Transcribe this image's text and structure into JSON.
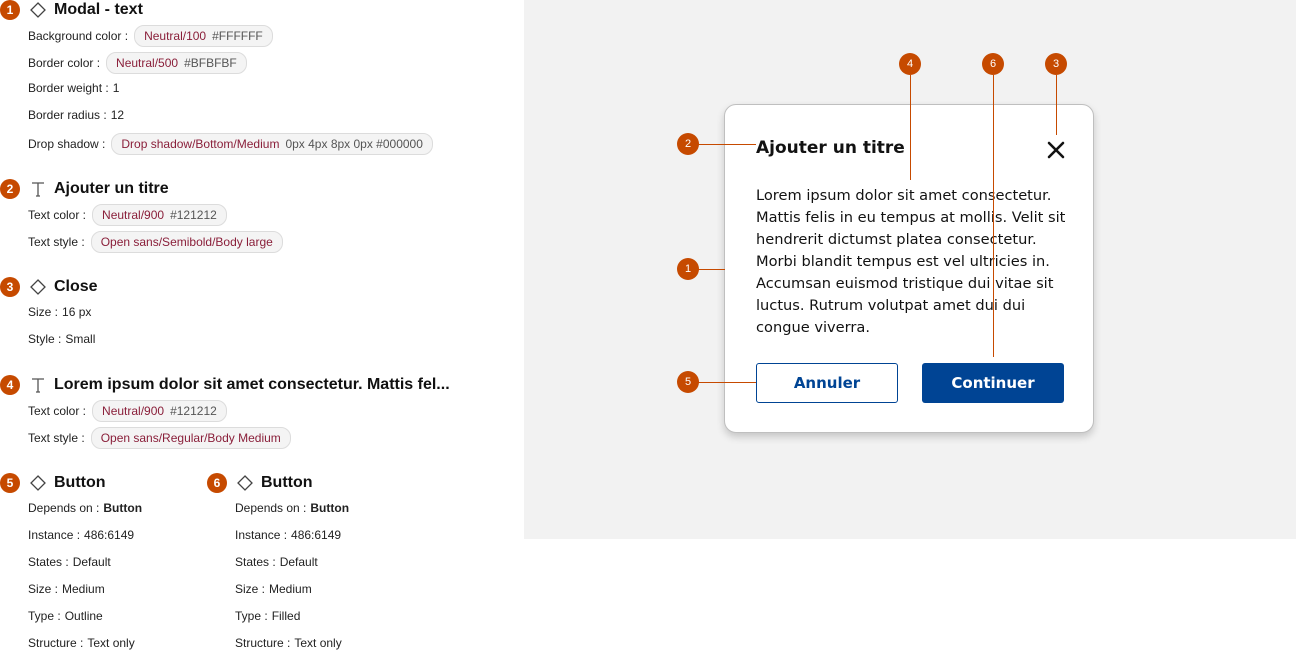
{
  "sections": {
    "s1": {
      "number": "1",
      "title": "Modal - text",
      "bg": {
        "label": "Background color :",
        "token": "Neutral/100",
        "value": "#FFFFFF"
      },
      "border_color": {
        "label": "Border color :",
        "token": "Neutral/500",
        "value": "#BFBFBF"
      },
      "border_weight": {
        "label": "Border weight :",
        "value": "1"
      },
      "border_radius": {
        "label": "Border radius :",
        "value": "12"
      },
      "shadow": {
        "label": "Drop shadow :",
        "token": "Drop shadow/Bottom/Medium",
        "value": "0px 4px 8px 0px #000000"
      }
    },
    "s2": {
      "number": "2",
      "title": "Ajouter un titre",
      "text_color": {
        "label": "Text color :",
        "token": "Neutral/900",
        "value": "#121212"
      },
      "text_style": {
        "label": "Text style :",
        "token": "Open sans/Semibold/Body large"
      }
    },
    "s3": {
      "number": "3",
      "title": "Close",
      "size": {
        "label": "Size :",
        "value": "16 px"
      },
      "style": {
        "label": "Style :",
        "value": "Small"
      }
    },
    "s4": {
      "number": "4",
      "title": "Lorem ipsum dolor sit amet consectetur. Mattis fel...",
      "text_color": {
        "label": "Text color :",
        "token": "Neutral/900",
        "value": "#121212"
      },
      "text_style": {
        "label": "Text style :",
        "token": "Open sans/Regular/Body Medium"
      }
    },
    "s5": {
      "number": "5",
      "title": "Button",
      "depends": {
        "label": "Depends on :",
        "value": "Button"
      },
      "instance": {
        "label": "Instance :",
        "value": "486:6149"
      },
      "states": {
        "label": "States :",
        "value": "Default"
      },
      "size": {
        "label": "Size :",
        "value": "Medium"
      },
      "type": {
        "label": "Type :",
        "value": "Outline"
      },
      "structure": {
        "label": "Structure :",
        "value": "Text only"
      }
    },
    "s6": {
      "number": "6",
      "title": "Button",
      "depends": {
        "label": "Depends on :",
        "value": "Button"
      },
      "instance": {
        "label": "Instance :",
        "value": "486:6149"
      },
      "states": {
        "label": "States :",
        "value": "Default"
      },
      "size": {
        "label": "Size :",
        "value": "Medium"
      },
      "type": {
        "label": "Type :",
        "value": "Filled"
      },
      "structure": {
        "label": "Structure :",
        "value": "Text only"
      }
    }
  },
  "modal": {
    "title": "Ajouter un titre",
    "body": "Lorem ipsum dolor sit amet consectetur. Mattis felis in eu tempus at mollis. Velit sit hendrerit dictumst platea consectetur. Morbi blandit tempus est vel ultricies in. Accumsan euismod tristique dui vitae sit luctus. Rutrum volutpat amet dui dui congue viverra.",
    "cancel_label": "Annuler",
    "continue_label": "Continuer",
    "close_icon": "close-icon"
  },
  "callouts": {
    "c1": "1",
    "c2": "2",
    "c3": "3",
    "c4": "4",
    "c5": "5",
    "c6": "6"
  },
  "colors": {
    "accent": "#C64A00",
    "primary": "#004494",
    "text": "#121212",
    "canvas": "#F2F2F2",
    "border": "#BFBFBF"
  },
  "icons": {
    "component": "diamond-icon",
    "text": "text-icon"
  }
}
